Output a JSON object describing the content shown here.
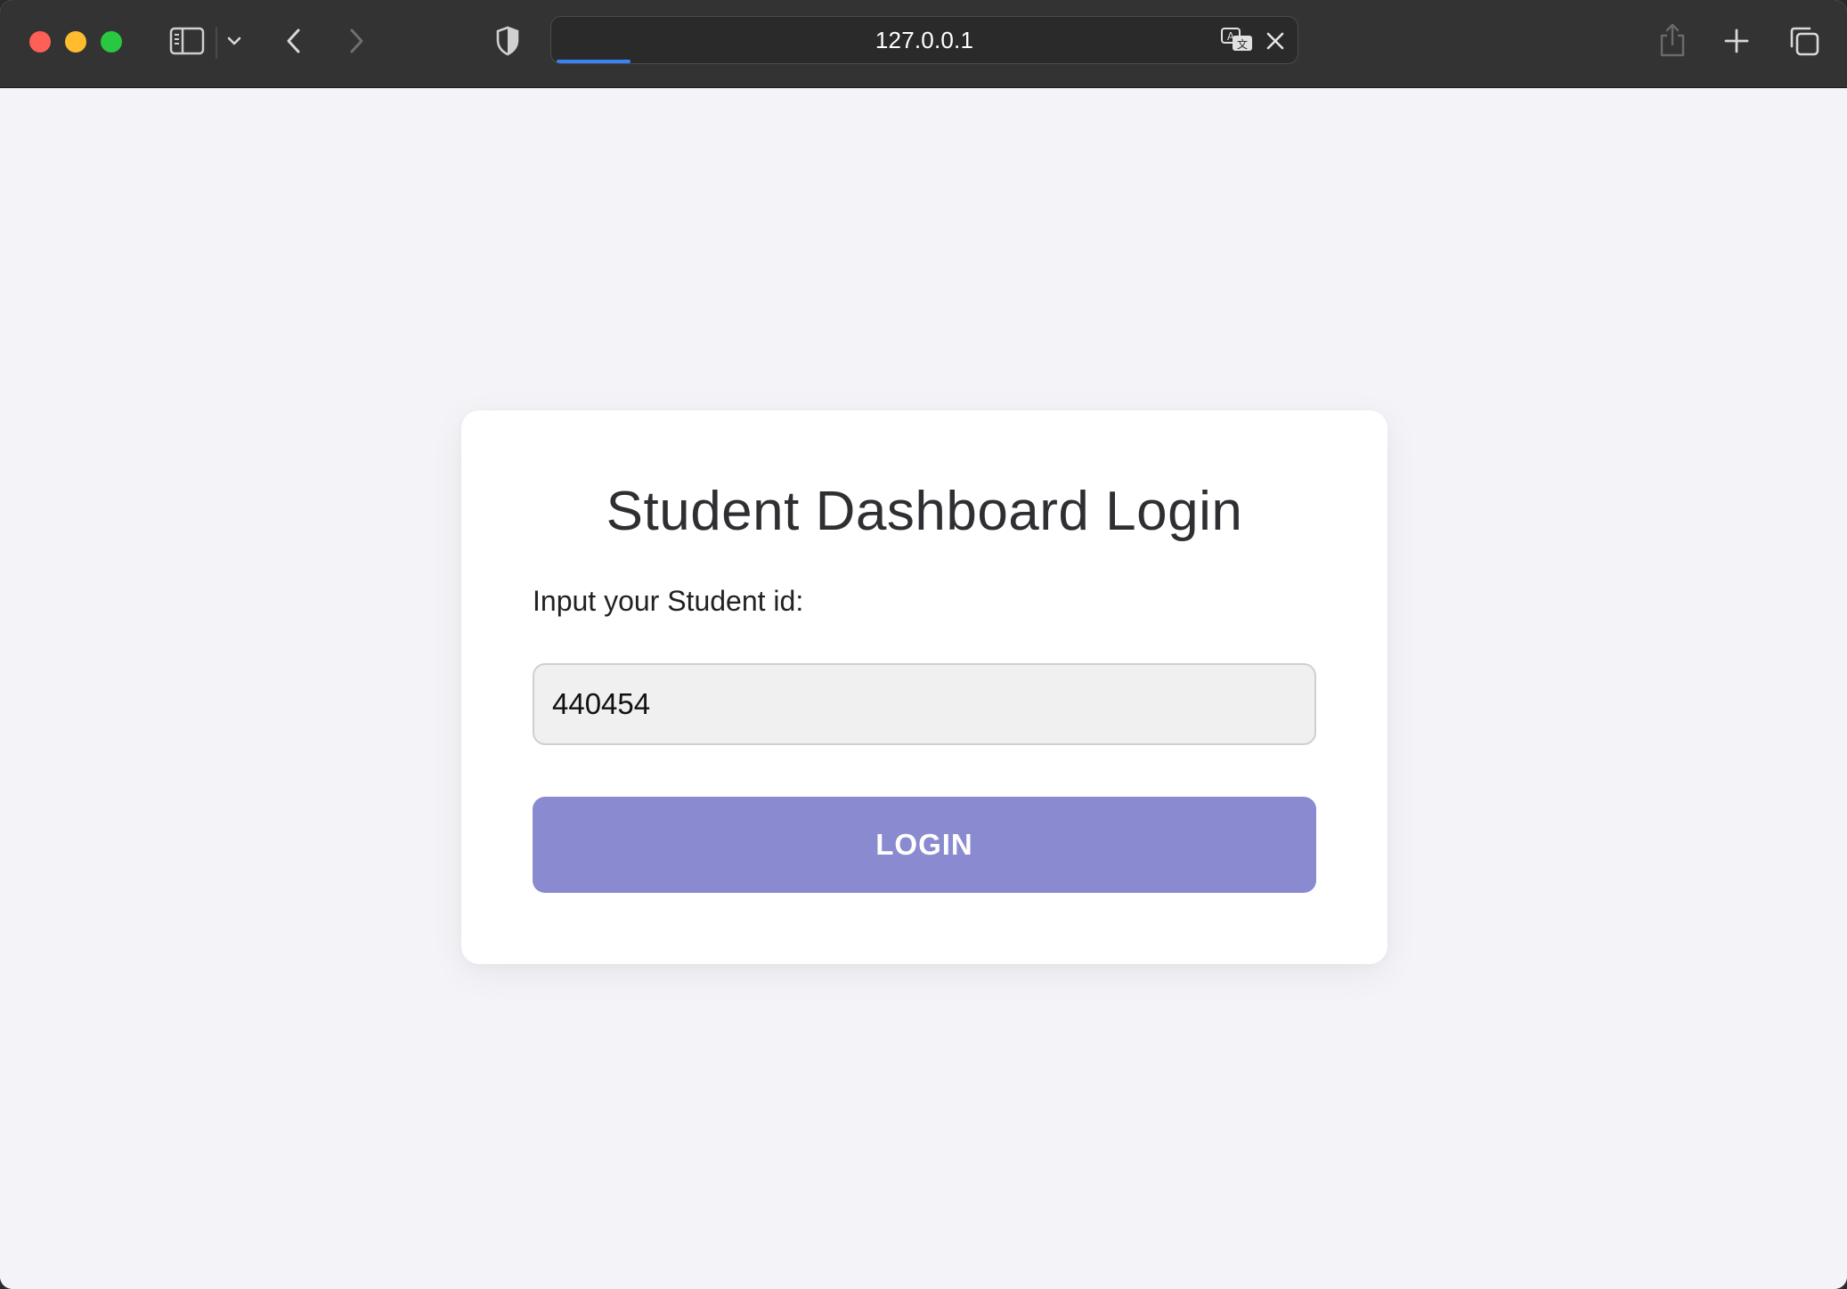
{
  "browser": {
    "address": "127.0.0.1",
    "load_progress": 0.1
  },
  "login_card": {
    "title": "Student Dashboard Login",
    "field_label": "Input your Student id:",
    "student_id_value": "440454",
    "button_label": "LOGIN"
  },
  "colors": {
    "toolbar_bg": "#333333",
    "page_bg": "#f4f4f8",
    "button_bg": "#8a8ad0",
    "input_bg": "#f0f0f0",
    "progress": "#3b82f6"
  },
  "icons": {
    "sidebar": "sidebar-icon",
    "chevron": "chevron-down-icon",
    "back": "back-arrow-icon",
    "forward": "forward-arrow-icon",
    "privacy": "shield-icon",
    "translate": "translate-icon",
    "stop": "close-icon",
    "share": "share-icon",
    "new_tab": "plus-icon",
    "tabs": "tab-overview-icon"
  }
}
